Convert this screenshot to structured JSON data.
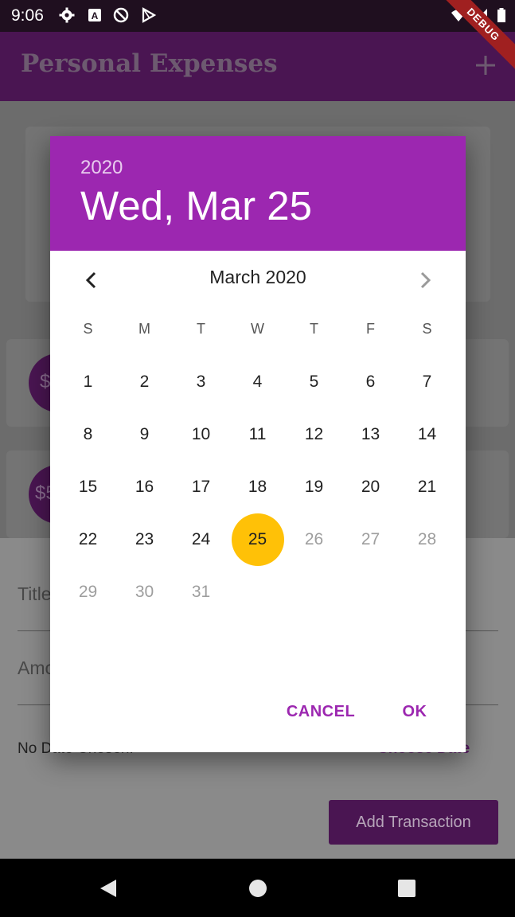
{
  "status_bar": {
    "time": "9:06",
    "icons": [
      "gear-icon",
      "a-icon",
      "no-signal-circle-icon",
      "play-store-icon",
      "wifi-icon",
      "signal-icon",
      "battery-icon"
    ],
    "debug_label": "DEBUG"
  },
  "app_bar": {
    "title": "Personal Expenses",
    "add_icon": "plus-icon"
  },
  "background": {
    "avatar_1": "$",
    "avatar_2": "$5",
    "title_label": "Title",
    "amount_label": "Amo",
    "no_date_text": "No Date Chosen!",
    "choose_date": "Choose Date",
    "add_transaction": "Add Transaction"
  },
  "dialog": {
    "year": "2020",
    "selected_date": "Wed, Mar 25",
    "month_label": "March 2020",
    "weekdays": [
      "S",
      "M",
      "T",
      "W",
      "T",
      "F",
      "S"
    ],
    "weeks": [
      [
        "",
        "",
        "",
        "",
        "",
        "",
        ""
      ],
      [
        "1",
        "2",
        "3",
        "4",
        "5",
        "6",
        "7"
      ],
      [
        "8",
        "9",
        "10",
        "11",
        "12",
        "13",
        "14"
      ],
      [
        "15",
        "16",
        "17",
        "18",
        "19",
        "20",
        "21"
      ],
      [
        "22",
        "23",
        "24",
        "25",
        "26",
        "27",
        "28"
      ],
      [
        "29",
        "30",
        "31",
        "",
        "",
        "",
        ""
      ]
    ],
    "selected_day": "25",
    "disabled_after": 25,
    "cancel_label": "CANCEL",
    "ok_label": "OK"
  },
  "colors": {
    "header": "#9c27b0",
    "selected_day": "#ffc107",
    "app_bar": "#4a1552"
  }
}
